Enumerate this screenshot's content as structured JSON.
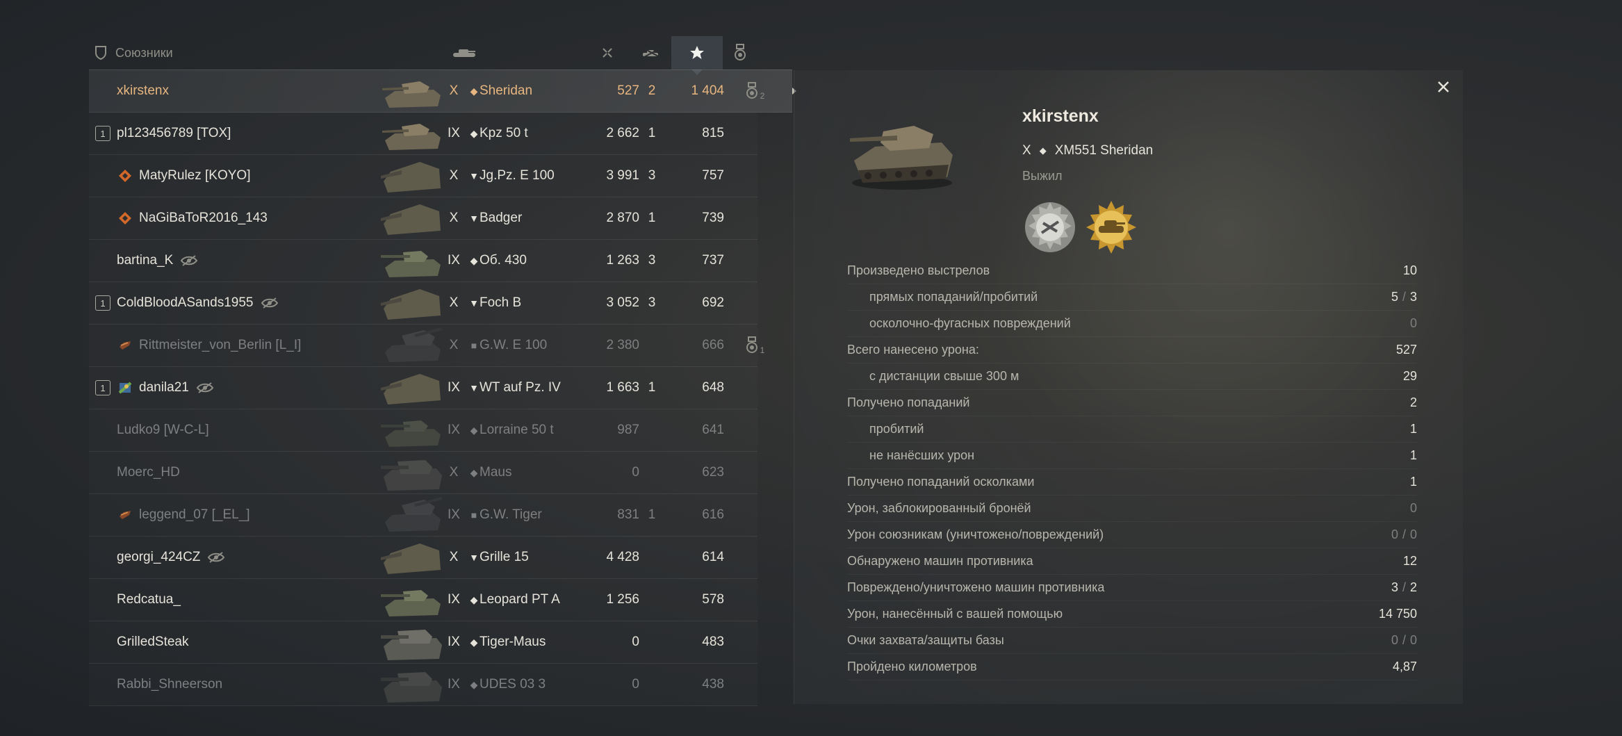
{
  "header": {
    "team_label": "Союзники",
    "sorted_column": "xp"
  },
  "players": [
    {
      "platoon": "",
      "clan_icon": "",
      "name": "xkirstenx",
      "hidden": false,
      "tier": "X",
      "type": "light-tank",
      "vehicle": "Sheridan",
      "damage": "527",
      "kills": "2",
      "xp": "1 404",
      "medal": "2",
      "me": true,
      "dead": false
    },
    {
      "platoon": "1",
      "clan_icon": "",
      "name": "pl123456789 [TOX]",
      "hidden": false,
      "tier": "IX",
      "type": "light-tank",
      "vehicle": "Kpz 50 t",
      "damage": "2 662",
      "kills": "1",
      "xp": "815",
      "medal": "",
      "me": false,
      "dead": false
    },
    {
      "platoon": "",
      "clan_icon": "orange-badge",
      "name": "MatyRulez [KOYO]",
      "hidden": false,
      "tier": "X",
      "type": "tank-destroyer",
      "vehicle": "Jg.Pz. E 100",
      "damage": "3 991",
      "kills": "3",
      "xp": "757",
      "medal": "",
      "me": false,
      "dead": false
    },
    {
      "platoon": "",
      "clan_icon": "orange-badge",
      "name": "NaGiBaToR2016_143",
      "hidden": false,
      "tier": "X",
      "type": "tank-destroyer",
      "vehicle": "Badger",
      "damage": "2 870",
      "kills": "1",
      "xp": "739",
      "medal": "",
      "me": false,
      "dead": false
    },
    {
      "platoon": "",
      "clan_icon": "",
      "name": "bartina_K",
      "hidden": true,
      "tier": "IX",
      "type": "medium-tank",
      "vehicle": "Об. 430",
      "damage": "1 263",
      "kills": "3",
      "xp": "737",
      "medal": "",
      "me": false,
      "dead": false
    },
    {
      "platoon": "1",
      "clan_icon": "",
      "name": "ColdBloodASands1955",
      "hidden": true,
      "tier": "X",
      "type": "tank-destroyer",
      "vehicle": "Foch B",
      "damage": "3 052",
      "kills": "3",
      "xp": "692",
      "medal": "",
      "me": false,
      "dead": false
    },
    {
      "platoon": "",
      "clan_icon": "brown-badge",
      "name": "Rittmeister_von_Berlin [L_I]",
      "hidden": false,
      "tier": "X",
      "type": "spg",
      "vehicle": "G.W. E 100",
      "damage": "2 380",
      "kills": "",
      "xp": "666",
      "medal": "1",
      "me": false,
      "dead": true
    },
    {
      "platoon": "1",
      "clan_icon": "flag-badge",
      "name": "danila21",
      "hidden": true,
      "tier": "IX",
      "type": "tank-destroyer",
      "vehicle": "WT auf Pz. IV",
      "damage": "1 663",
      "kills": "1",
      "xp": "648",
      "medal": "",
      "me": false,
      "dead": false
    },
    {
      "platoon": "",
      "clan_icon": "",
      "name": "Ludko9 [W-C-L]",
      "hidden": false,
      "tier": "IX",
      "type": "medium-tank",
      "vehicle": "Lorraine 50 t",
      "damage": "987",
      "kills": "",
      "xp": "641",
      "medal": "",
      "me": false,
      "dead": true
    },
    {
      "platoon": "",
      "clan_icon": "",
      "name": "Moerc_HD",
      "hidden": false,
      "tier": "X",
      "type": "heavy-tank",
      "vehicle": "Maus",
      "damage": "0",
      "kills": "",
      "xp": "623",
      "medal": "",
      "me": false,
      "dead": true
    },
    {
      "platoon": "",
      "clan_icon": "brown-badge",
      "name": "leggend_07 [_EL_]",
      "hidden": false,
      "tier": "IX",
      "type": "spg",
      "vehicle": "G.W. Tiger",
      "damage": "831",
      "kills": "1",
      "xp": "616",
      "medal": "",
      "me": false,
      "dead": true
    },
    {
      "platoon": "",
      "clan_icon": "",
      "name": "georgi_424CZ",
      "hidden": true,
      "tier": "X",
      "type": "tank-destroyer",
      "vehicle": "Grille 15",
      "damage": "4 428",
      "kills": "",
      "xp": "614",
      "medal": "",
      "me": false,
      "dead": false
    },
    {
      "platoon": "",
      "clan_icon": "",
      "name": "Redcatua_",
      "hidden": false,
      "tier": "IX",
      "type": "medium-tank",
      "vehicle": "Leopard PT A",
      "damage": "1 256",
      "kills": "",
      "xp": "578",
      "medal": "",
      "me": false,
      "dead": false
    },
    {
      "platoon": "",
      "clan_icon": "",
      "name": "GrilledSteak",
      "hidden": false,
      "tier": "IX",
      "type": "heavy-tank",
      "vehicle": "Tiger-Maus",
      "damage": "0",
      "kills": "",
      "xp": "483",
      "medal": "",
      "me": false,
      "dead": false
    },
    {
      "platoon": "",
      "clan_icon": "",
      "name": "Rabbi_Shneerson",
      "hidden": false,
      "tier": "IX",
      "type": "heavy-tank",
      "vehicle": "UDES 03 3",
      "damage": "0",
      "kills": "",
      "xp": "438",
      "medal": "",
      "me": false,
      "dead": true
    }
  ],
  "detail": {
    "name": "xkirstenx",
    "tier": "X",
    "vehicle": "XM551 Sheridan",
    "status": "Выжил",
    "medals": [
      "medal-gunner-icon",
      "medal-tank-expert-icon"
    ],
    "stats": [
      {
        "label": "Произведено выстрелов",
        "sub": false,
        "value": "10"
      },
      {
        "label": "прямых попаданий/пробитий",
        "sub": true,
        "value": "5",
        "value2": "3"
      },
      {
        "label": "осколочно-фугасных повреждений",
        "sub": true,
        "value": "0",
        "zero": true
      },
      {
        "label": "Всего нанесено урона:",
        "sub": false,
        "value": "527"
      },
      {
        "label": "с дистанции свыше 300 м",
        "sub": true,
        "value": "29"
      },
      {
        "label": "Получено попаданий",
        "sub": false,
        "value": "2"
      },
      {
        "label": "пробитий",
        "sub": true,
        "value": "1"
      },
      {
        "label": "не нанёсших урон",
        "sub": true,
        "value": "1"
      },
      {
        "label": "Получено попаданий осколками",
        "sub": false,
        "value": "1"
      },
      {
        "label": "Урон, заблокированный бронёй",
        "sub": false,
        "value": "0",
        "zero": true
      },
      {
        "label": "Урон союзникам (уничтожено/повреждений)",
        "sub": false,
        "value": "0",
        "value2": "0",
        "zero": true
      },
      {
        "label": "Обнаружено машин противника",
        "sub": false,
        "value": "12"
      },
      {
        "label": "Повреждено/уничтожено машин противника",
        "sub": false,
        "value": "3",
        "value2": "2"
      },
      {
        "label": "Урон, нанесённый с вашей помощью",
        "sub": false,
        "value": "14 750"
      },
      {
        "label": "Очки захвата/защиты базы",
        "sub": false,
        "value": "0",
        "value2": "0",
        "zero": true
      },
      {
        "label": "Пройдено километров",
        "sub": false,
        "value": "4,87"
      }
    ]
  }
}
